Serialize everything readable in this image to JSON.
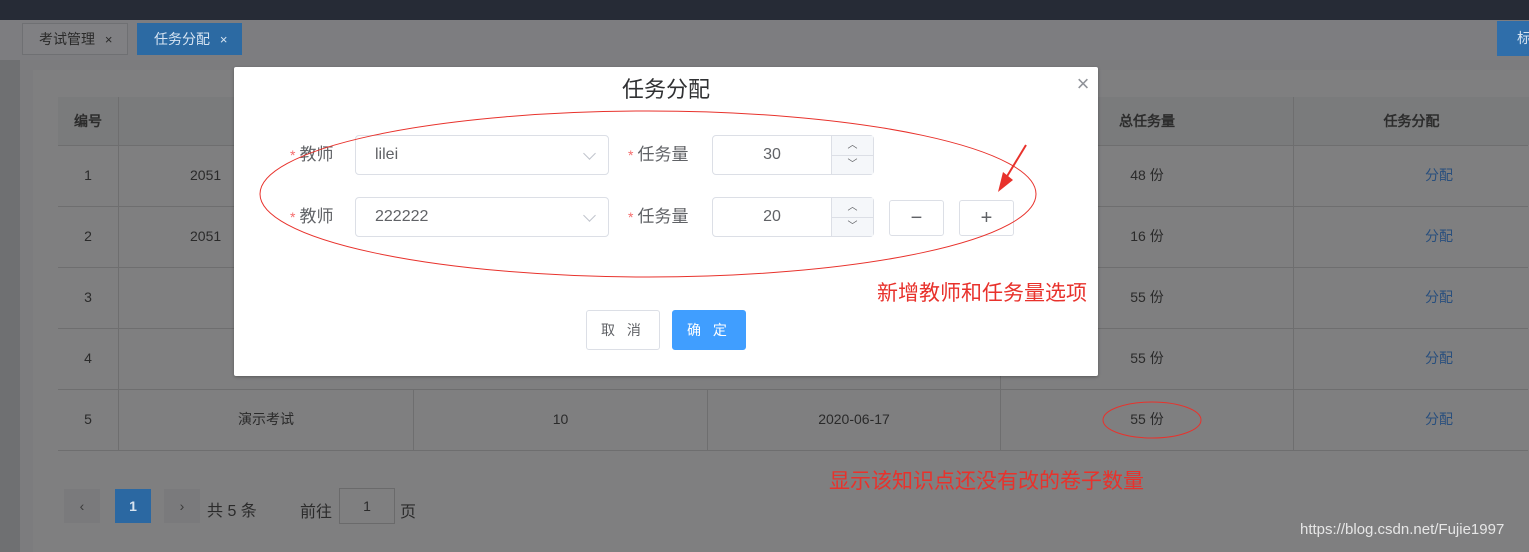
{
  "tabs": [
    {
      "label": "考试管理",
      "close": "×"
    },
    {
      "label": "任务分配",
      "close": "×"
    }
  ],
  "right_button_label": "标",
  "table": {
    "headers": [
      "编号",
      "总任务量",
      "任务分配"
    ],
    "rows": [
      {
        "id": "1",
        "name": "2051",
        "count": "",
        "date": "",
        "total": "48 份",
        "action": "分配"
      },
      {
        "id": "2",
        "name": "2051",
        "count": "",
        "date": "",
        "total": "16 份",
        "action": "分配"
      },
      {
        "id": "3",
        "name": "",
        "count": "",
        "date": "",
        "total": "55 份",
        "action": "分配"
      },
      {
        "id": "4",
        "name": "",
        "count": "",
        "date": "",
        "total": "55 份",
        "action": "分配"
      },
      {
        "id": "5",
        "name": "演示考试",
        "count": "10",
        "date": "2020-06-17",
        "total": "55 份",
        "action": "分配"
      }
    ]
  },
  "pagination": {
    "prev": "‹",
    "current": "1",
    "next": "›",
    "total_text": "共 5 条",
    "goto_label": "前往",
    "goto_value": "1",
    "page_suffix": "页"
  },
  "modal": {
    "title": "任务分配",
    "close": "×",
    "required_mark": "*",
    "teacher_label": "教师",
    "task_label": "任务量",
    "rows": [
      {
        "teacher": "lilei",
        "amount": "30"
      },
      {
        "teacher": "222222",
        "amount": "20"
      }
    ],
    "minus": "−",
    "plus": "+",
    "cancel": "取 消",
    "confirm": "确 定"
  },
  "annotations": {
    "add_note": "新增教师和任务量选项",
    "count_note": "显示该知识点还没有改的卷子数量",
    "color": "#e8322c"
  },
  "watermark": "https://blog.csdn.net/Fujie1997"
}
